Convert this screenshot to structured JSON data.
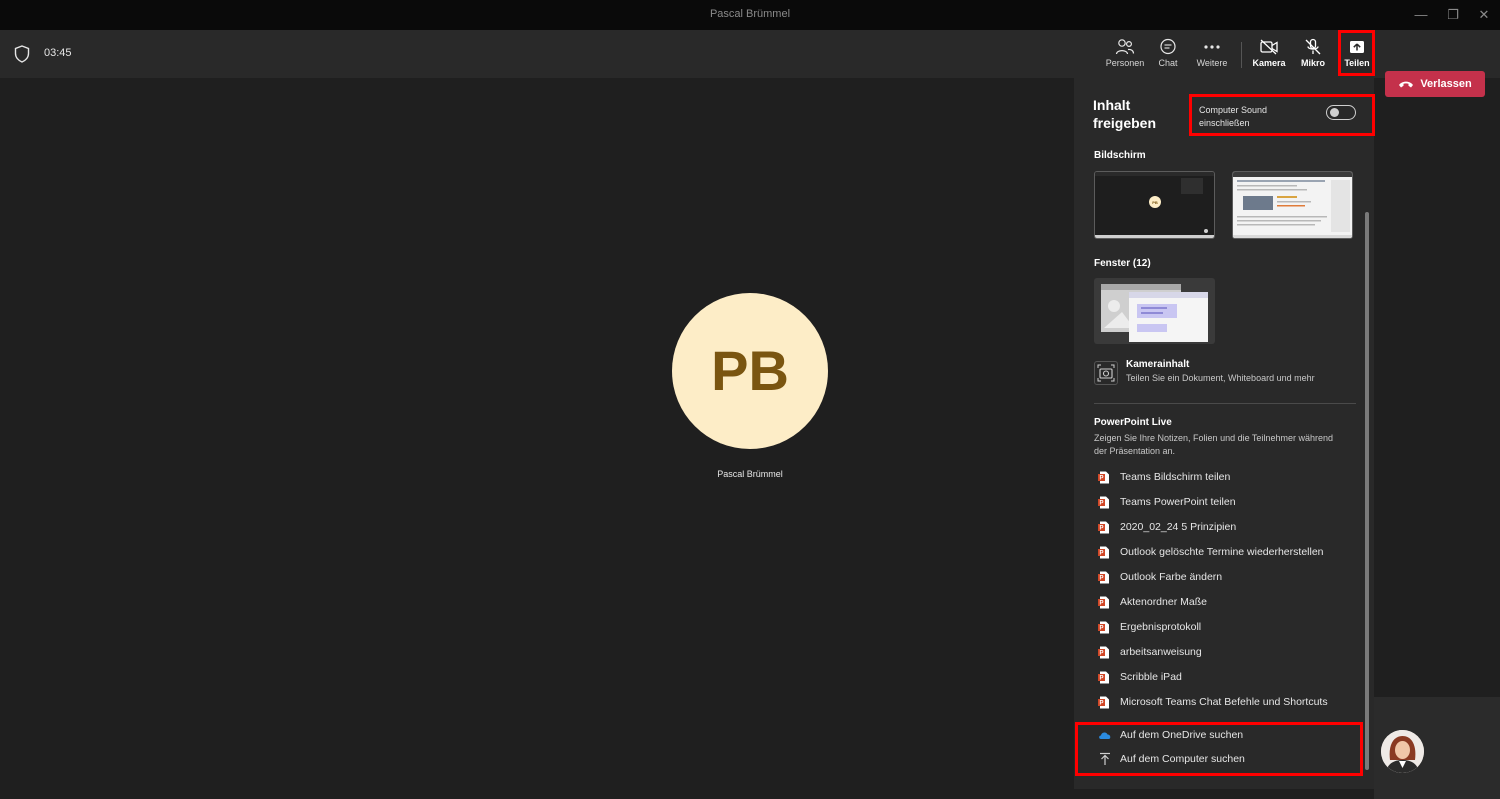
{
  "window": {
    "title": "Pascal Brümmel"
  },
  "toolbar": {
    "timer": "03:45",
    "people_label": "Personen",
    "chat_label": "Chat",
    "more_label": "Weitere",
    "camera_label": "Kamera",
    "mic_label": "Mikro",
    "share_label": "Teilen",
    "leave_label": "Verlassen",
    "leave_color": "#c4314b"
  },
  "stage": {
    "avatar_initials": "PB",
    "participant_name": "Pascal Brümmel",
    "avatar_bg": "#fdedc7"
  },
  "share_panel": {
    "title": "Inhalt freigeben",
    "sound_toggle_label": "Computer Sound einschließen",
    "sound_toggle_on": false,
    "screen_section": "Bildschirm",
    "window_section": "Fenster (12)",
    "camera_content_title": "Kamerainhalt",
    "camera_content_sub": "Teilen Sie ein Dokument, Whiteboard und mehr",
    "ppt_section": "PowerPoint Live",
    "ppt_description": "Zeigen Sie Ihre Notizen, Folien und die Teilnehmer während der Präsentation an.",
    "files": [
      "Teams Bildschirm teilen",
      "Teams PowerPoint teilen",
      "2020_02_24 5 Prinzipien",
      "Outlook gelöschte Termine wiederherstellen",
      "Outlook Farbe ändern",
      "Aktenordner Maße",
      "Ergebnisprotokoll",
      "arbeitsanweisung",
      "Scribble iPad",
      "Microsoft Teams Chat Befehle und Shortcuts"
    ],
    "onedrive_label": "Auf dem OneDrive suchen",
    "computer_label": "Auf dem Computer suchen",
    "thumb_avatar": "PB"
  }
}
